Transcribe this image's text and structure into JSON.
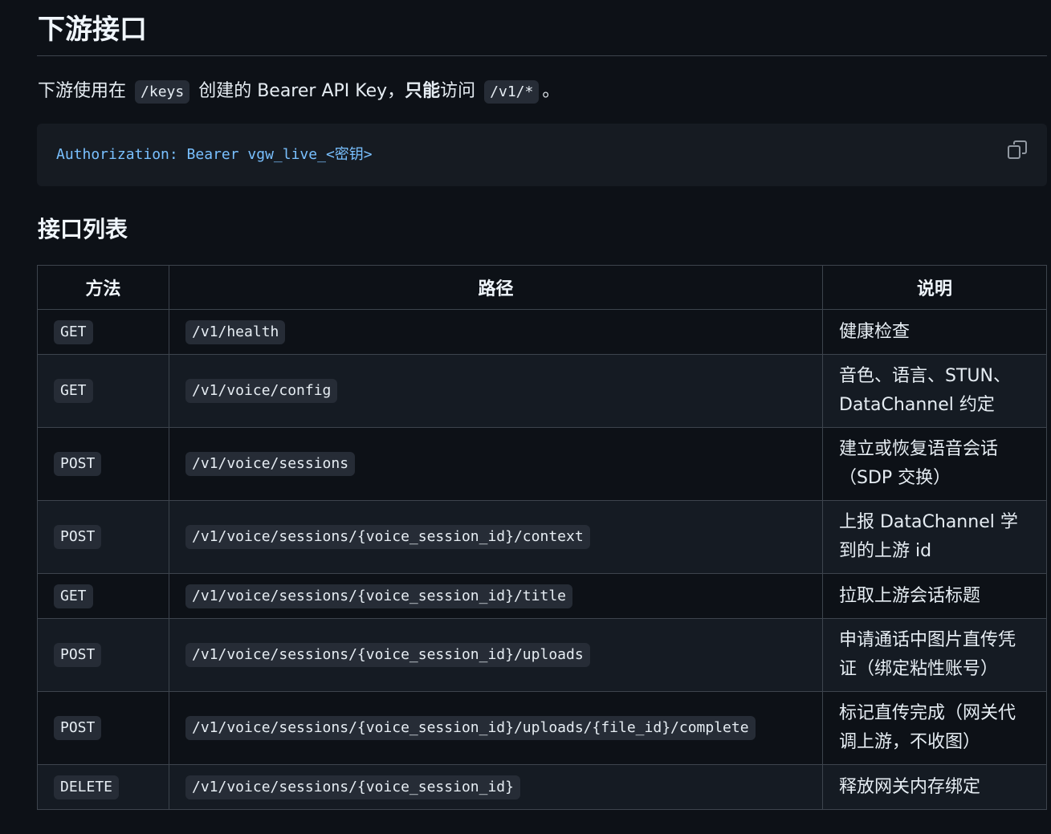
{
  "heading": "下游接口",
  "intro": {
    "part1": "下游使用在",
    "code1": "/keys",
    "part2": "创建的 Bearer API Key，",
    "bold": "只能",
    "part3": "访问",
    "code2": "/v1/*",
    "part4": "。"
  },
  "code_block": {
    "key": "Authorization:",
    "value": " Bearer vgw_live_<密钥>",
    "copy_icon": "copy-icon"
  },
  "subheading": "接口列表",
  "table": {
    "headers": [
      "方法",
      "路径",
      "说明"
    ],
    "rows": [
      {
        "method": "GET",
        "path": "/v1/health",
        "desc": "健康检查"
      },
      {
        "method": "GET",
        "path": "/v1/voice/config",
        "desc": "音色、语言、STUN、DataChannel 约定"
      },
      {
        "method": "POST",
        "path": "/v1/voice/sessions",
        "desc": "建立或恢复语音会话（SDP 交换）"
      },
      {
        "method": "POST",
        "path": "/v1/voice/sessions/{voice_session_id}/context",
        "desc": "上报 DataChannel 学到的上游 id"
      },
      {
        "method": "GET",
        "path": "/v1/voice/sessions/{voice_session_id}/title",
        "desc": "拉取上游会话标题"
      },
      {
        "method": "POST",
        "path": "/v1/voice/sessions/{voice_session_id}/uploads",
        "desc": "申请通话中图片直传凭证（绑定粘性账号）"
      },
      {
        "method": "POST",
        "path": "/v1/voice/sessions/{voice_session_id}/uploads/{file_id}/complete",
        "desc": "标记直传完成（网关代调上游，不收图）"
      },
      {
        "method": "DELETE",
        "path": "/v1/voice/sessions/{voice_session_id}",
        "desc": "释放网关内存绑定"
      }
    ]
  },
  "colors": {
    "background": "#0d1117",
    "code_key": "#79c0ff",
    "border": "#3d444d"
  }
}
